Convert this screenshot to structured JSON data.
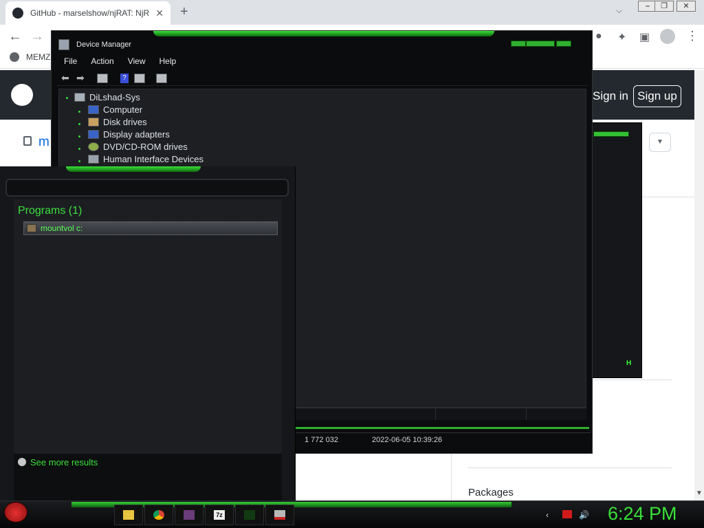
{
  "browser": {
    "tab_title": "GitHub - marselshow/njRAT: NjR",
    "tab_close": "✕",
    "new_tab": "+",
    "tab_dropdown": "⌵",
    "window_buttons": [
      "⎯",
      "❐",
      "✕"
    ],
    "back": "←",
    "forward": "→",
    "bookmark": "MEMZ",
    "kebab": "⋮"
  },
  "github": {
    "sign_in": "Sign in",
    "sign_up": "Sign up",
    "repo_name_fragment": "m",
    "packages_heading": "Packages"
  },
  "background_window": {
    "letter": "H"
  },
  "device_manager": {
    "title": "Device Manager",
    "menu": [
      "File",
      "Action",
      "View",
      "Help"
    ],
    "root": "DiLshad-Sys",
    "tree_items": [
      "Computer",
      "Disk drives",
      "Display adapters",
      "DVD/CD-ROM drives",
      "Human Interface Devices"
    ],
    "info_size": "1 772 032",
    "info_date": "2022-06-05 10:39:26"
  },
  "start_menu": {
    "programs_heading": "Programs (1)",
    "result": "mountvol c:",
    "see_more": "See more results"
  },
  "taskbar": {
    "clock": "6:24 PM",
    "apps": [
      "folder-icon",
      "chrome-icon",
      "paint-icon",
      "7zip-icon",
      "njrat-icon",
      "device-manager-icon"
    ],
    "accent": "#3ae03a"
  }
}
